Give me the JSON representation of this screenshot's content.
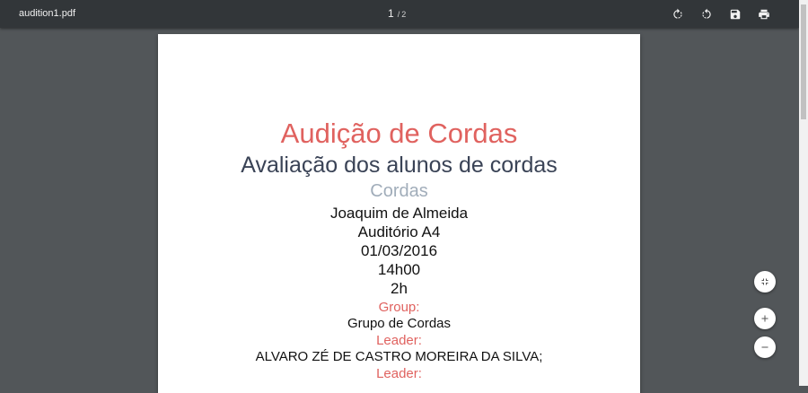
{
  "toolbar": {
    "filename": "audition1.pdf",
    "current_page": "1",
    "page_separator": "/",
    "total_pages": "2",
    "buttons": [
      {
        "name": "rotate-clockwise",
        "icon": "rotate-clockwise-icon"
      },
      {
        "name": "rotate-counterclockwise",
        "icon": "rotate-counterclockwise-icon"
      },
      {
        "name": "download",
        "icon": "save-icon"
      },
      {
        "name": "print",
        "icon": "print-icon"
      }
    ]
  },
  "document": {
    "title": "Audição de Cordas",
    "subtitle": "Avaliação dos alunos de cordas",
    "category": "Cordas",
    "teacher": "Joaquim de Almeida",
    "room": "Auditório A4",
    "date": "01/03/2016",
    "time": "14h00",
    "duration": "2h",
    "group_label": "Group:",
    "group_value": "Grupo de Cordas",
    "leader_label": "Leader:",
    "leader_value": "ALVARO ZÉ DE CASTRO MOREIRA DA SILVA;",
    "leader_label_2": "Leader:"
  },
  "zoom_controls": {
    "fit": "fit-to-page-icon",
    "zoom_in": "plus-icon",
    "zoom_out": "minus-icon"
  },
  "colors": {
    "toolbar_bg": "#323639",
    "viewer_bg": "#525659",
    "accent_red": "#e0625f",
    "subtitle": "#3a4356",
    "category": "#a1adba"
  }
}
